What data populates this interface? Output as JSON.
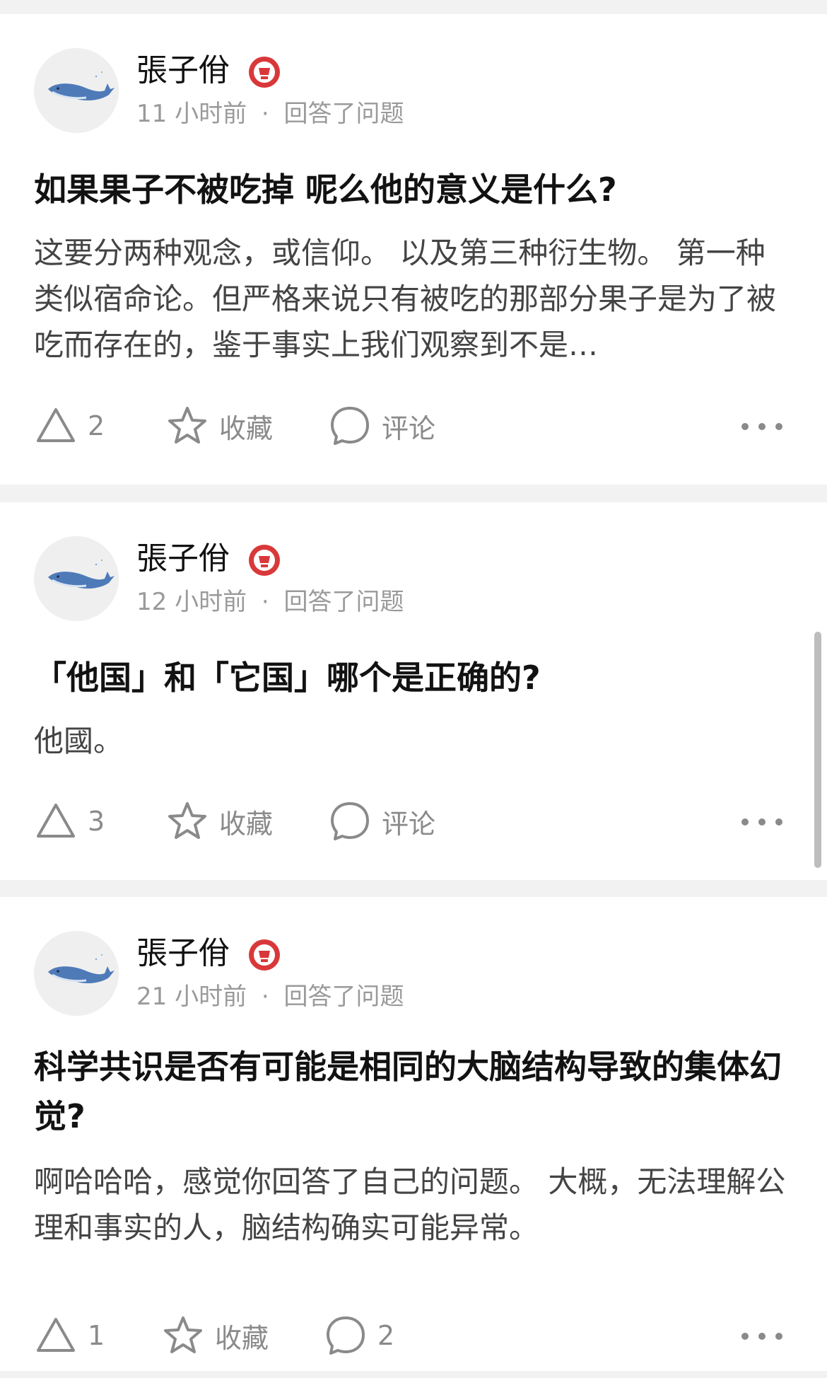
{
  "feed": {
    "items": [
      {
        "author": "張子佾",
        "time": "11 小时前",
        "separator": "·",
        "action": "回答了问题",
        "title": "如果果子不被吃掉 呢么他的意义是什么?",
        "excerpt": "这要分两种观念，或信仰。 以及第三种衍生物。 第一种类似宿命论。但严格来说只有被吃的那部分果子是为了被吃而存在的，鉴于事实上我们观察到不是…",
        "vote_count": "2",
        "favorite_label": "收藏",
        "comment_label": "评论"
      },
      {
        "author": "張子佾",
        "time": "12 小时前",
        "separator": "·",
        "action": "回答了问题",
        "title": "「他国」和「它国」哪个是正确的?",
        "excerpt": "他國。",
        "vote_count": "3",
        "favorite_label": "收藏",
        "comment_label": "评论"
      },
      {
        "author": "張子佾",
        "time": "21 小时前",
        "separator": "·",
        "action": "回答了问题",
        "title": "科学共识是否有可能是相同的大脑结构导致的集体幻觉?",
        "excerpt": "啊哈哈哈，感觉你回答了自己的问题。 大概，无法理解公理和事实的人，脑结构确实可能异常。",
        "vote_count": "1",
        "favorite_label": "收藏",
        "comment_label": "2"
      }
    ]
  },
  "icons": {
    "badge": "medal-badge-icon",
    "vote": "upvote-triangle-icon",
    "favorite": "star-icon",
    "comment": "comment-bubble-icon",
    "more": "more-dots-icon",
    "avatar": "whale-avatar"
  },
  "colors": {
    "badge_red": "#d9383a",
    "text_primary": "#121212",
    "text_secondary": "#9a9a9a",
    "icon_gray": "#8a8a8a",
    "divider": "#f2f2f3"
  }
}
